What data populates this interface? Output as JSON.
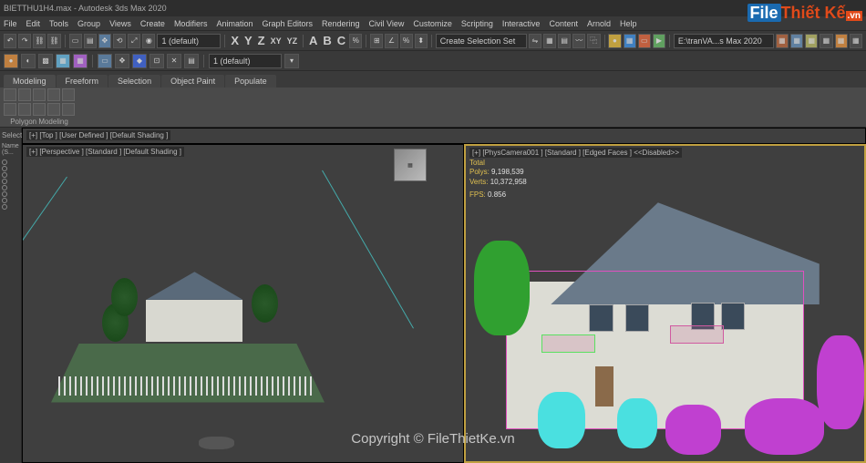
{
  "title": "BIETTHU1H4.max - Autodesk 3ds Max 2020",
  "menu": [
    "File",
    "Edit",
    "Tools",
    "Group",
    "Views",
    "Create",
    "Modifiers",
    "Animation",
    "Graph Editors",
    "Rendering",
    "Civil View",
    "Customize",
    "Scripting",
    "Interactive",
    "Content",
    "Arnold",
    "Help"
  ],
  "toolbar_dropdown1": "1 (default)",
  "toolbar_dropdown2": "Create Selection Set",
  "toolbar_path": "E:\\tranVA...s Max 2020",
  "big_letters": [
    "A",
    "B",
    "C"
  ],
  "ribbon_tabs": [
    "Modeling",
    "Freeform",
    "Selection",
    "Object Paint",
    "Populate"
  ],
  "ribbon_section": "Polygon Modeling",
  "left_panel": {
    "header": "Select",
    "name_label": "Name (S..."
  },
  "viewports": {
    "top": {
      "label": "[+] [Top ] [User Defined ] [Default Shading ]"
    },
    "persp": {
      "label": "[+] [Perspective ] [Standard ] [Default Shading ]"
    },
    "cam": {
      "label": "[+] [PhysCamera001 ] [Standard ] [Edged Faces ] <<Disabled>>",
      "stats_title": "Total",
      "polys_label": "Polys:",
      "polys_val": "9,198,539",
      "verts_label": "Verts:",
      "verts_val": "10,372,958",
      "fps_label": "FPS:",
      "fps_val": "0.856"
    }
  },
  "watermark_logo_file": "File",
  "watermark_logo_thietke": "Thiết Kế",
  "watermark_logo_vn": ".vn",
  "watermark_center": "Copyright © FileThietKe.vn"
}
